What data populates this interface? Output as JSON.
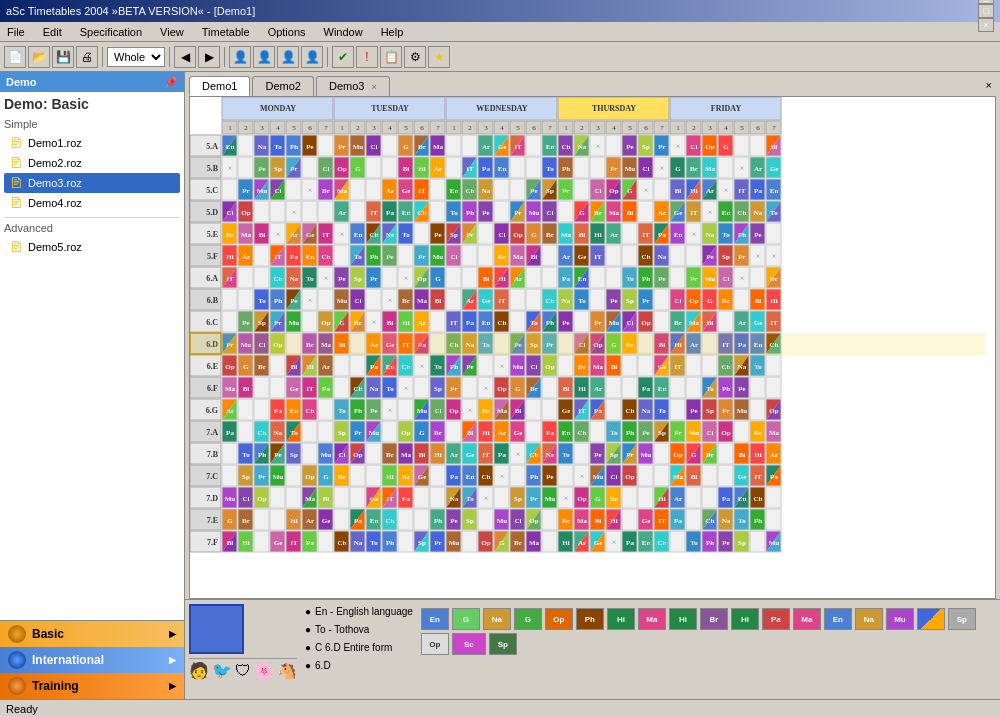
{
  "titleBar": {
    "text": "aSc Timetables 2004 »BETA VERSION« - [Demo1]",
    "controls": [
      "_",
      "□",
      "×"
    ]
  },
  "menuBar": {
    "items": [
      "File",
      "Edit",
      "Specification",
      "View",
      "Timetable",
      "Options",
      "Window",
      "Help"
    ]
  },
  "toolbar": {
    "dropdownValue": "Whole",
    "icons": [
      "open",
      "save",
      "print",
      "search",
      "back",
      "forward",
      "person",
      "person2",
      "person3",
      "person4",
      "check",
      "warning",
      "doc",
      "settings",
      "star"
    ]
  },
  "leftPanel": {
    "header": "Demo",
    "title": "Demo: Basic",
    "simpleSection": "Simple",
    "files": [
      {
        "name": "Demo1.roz",
        "selected": false
      },
      {
        "name": "Demo2.roz",
        "selected": false
      },
      {
        "name": "Demo3.roz",
        "selected": true
      },
      {
        "name": "Demo4.roz",
        "selected": false
      }
    ],
    "advancedSection": "Advanced",
    "advancedFiles": [
      {
        "name": "Demo5.roz",
        "selected": false
      }
    ],
    "bottomTabs": [
      {
        "label": "Basic",
        "type": "basic"
      },
      {
        "label": "International",
        "type": "intl"
      },
      {
        "label": "Training",
        "type": "training"
      }
    ]
  },
  "demoTabs": [
    {
      "label": "Demo1",
      "active": true
    },
    {
      "label": "Demo2",
      "active": false
    },
    {
      "label": "Demo3",
      "active": false
    }
  ],
  "timetable": {
    "days": [
      "MONDAY",
      "TUESDAY",
      "WEDNESDAY",
      "THURSDAY",
      "FRIDAY"
    ],
    "classes": [
      "5.A",
      "5.B",
      "5.C",
      "5.D",
      "5.E",
      "5.F",
      "6.A",
      "6.B",
      "6.C",
      "6.D",
      "6.E",
      "6.F",
      "6.G",
      "7.A",
      "7.B",
      "7.C",
      "7.D",
      "7.E",
      "7.F"
    ]
  },
  "legend": {
    "items": [
      {
        "text": "En - English language",
        "color": "#4a7fd4"
      },
      {
        "text": "To - Tothova",
        "color": "#4a7fd4"
      },
      {
        "text": "C  6.D Entire form",
        "color": "#4a7fd4"
      },
      {
        "text": "6.D",
        "color": "#4a7fd4"
      }
    ],
    "cells": [
      "En",
      "G",
      "Na",
      "G",
      "Op",
      "Ph",
      "Hi",
      "Ma",
      "Hi",
      "Br",
      "Hi",
      "Pa",
      "Ma",
      "En",
      "Na"
    ]
  },
  "statusBar": {
    "text": "Ready"
  }
}
